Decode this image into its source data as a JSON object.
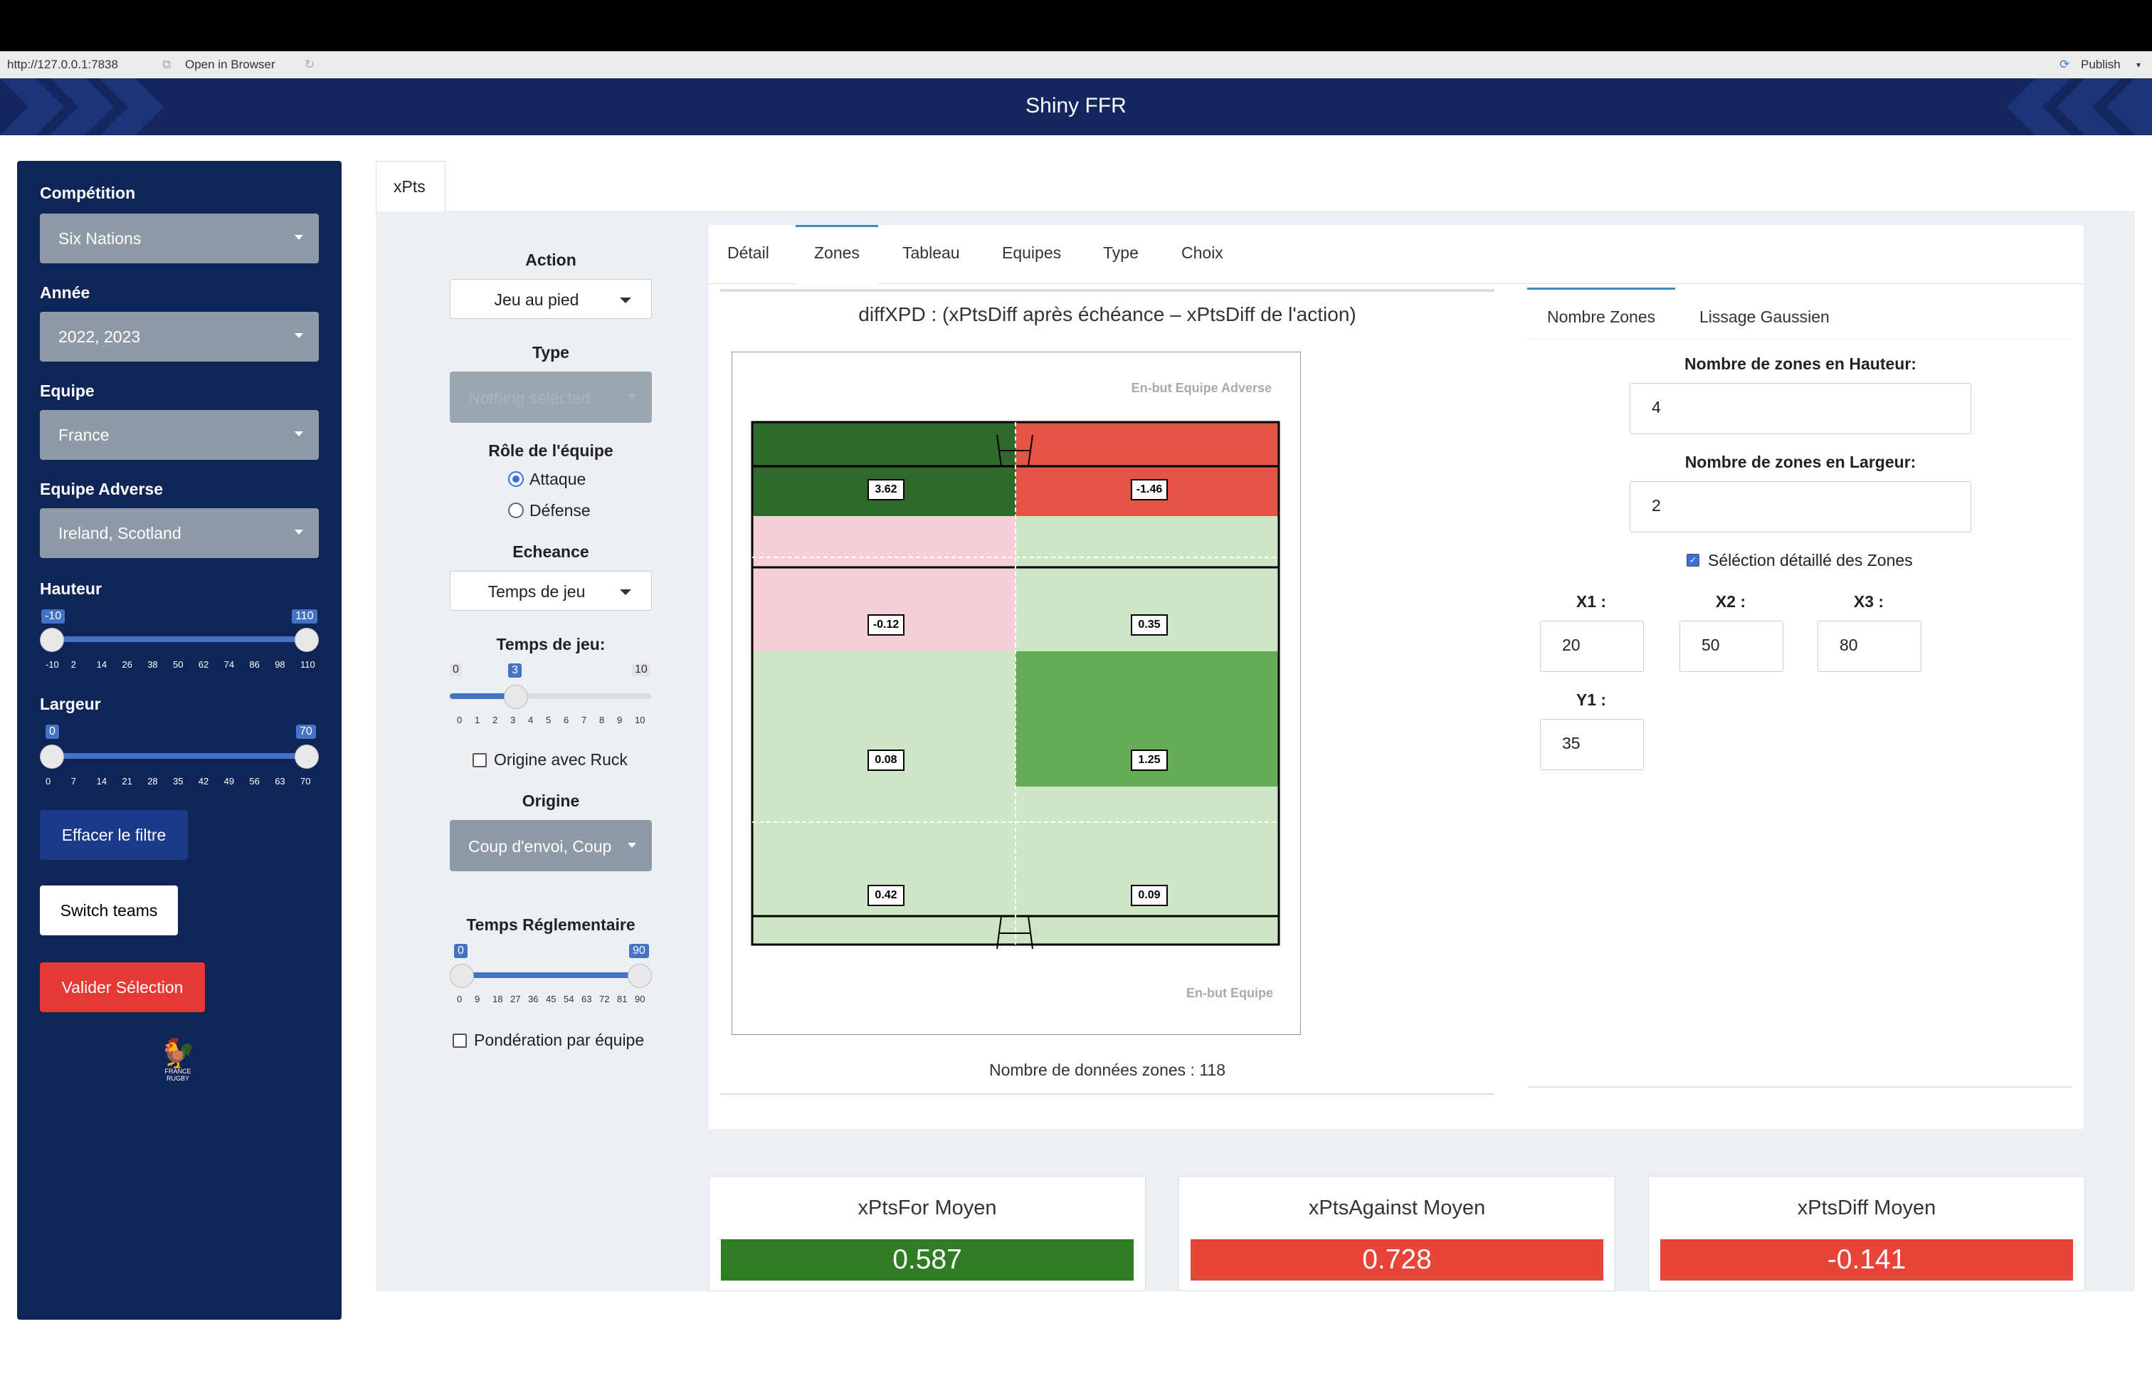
{
  "browser": {
    "url": "http://127.0.0.1:7838",
    "open_in_browser": "Open in Browser",
    "publish": "Publish"
  },
  "app": {
    "title": "Shiny FFR"
  },
  "sidebar": {
    "competition": {
      "label": "Compétition",
      "value": "Six Nations"
    },
    "annee": {
      "label": "Année",
      "value": "2022, 2023"
    },
    "equipe": {
      "label": "Equipe",
      "value": "France"
    },
    "equipe_adverse": {
      "label": "Equipe Adverse",
      "value": "Ireland, Scotland"
    },
    "hauteur": {
      "label": "Hauteur",
      "min_value": "-10",
      "max_value": "110",
      "ticks": [
        "-10",
        "2",
        "14",
        "26",
        "38",
        "50",
        "62",
        "74",
        "86",
        "98",
        "110"
      ]
    },
    "largeur": {
      "label": "Largeur",
      "min_value": "0",
      "max_value": "70",
      "ticks": [
        "0",
        "7",
        "14",
        "21",
        "28",
        "35",
        "42",
        "49",
        "56",
        "63",
        "70"
      ]
    },
    "clear_button": "Effacer le filtre",
    "switch_button": "Switch teams",
    "validate_button": "Valider Sélection",
    "logo_text_1": "FRANCE",
    "logo_text_2": "RUGBY",
    "colors": {
      "bg": "#0f2558",
      "validate": "#e53935",
      "clear": "#1b3a8c"
    }
  },
  "main_tab": "xPts",
  "controls": {
    "action": {
      "label": "Action",
      "value": "Jeu au pied"
    },
    "type": {
      "label": "Type",
      "placeholder": "Nothing selected"
    },
    "role": {
      "label": "Rôle de l'équipe",
      "options": [
        "Attaque",
        "Défense"
      ],
      "selected": "Attaque"
    },
    "echeance": {
      "label": "Echeance",
      "value": "Temps de jeu"
    },
    "temps_jeu": {
      "label": "Temps de jeu:",
      "min": "0",
      "value": "3",
      "max": "10",
      "ticks": [
        "0",
        "1",
        "2",
        "3",
        "4",
        "5",
        "6",
        "7",
        "8",
        "9",
        "10"
      ]
    },
    "origine_ruck": "Origine avec Ruck",
    "origine": {
      "label": "Origine",
      "value": "Coup d'envoi, Coup"
    },
    "temps_reglementaire": {
      "label": "Temps Réglementaire",
      "min_value": "0",
      "max_value": "90",
      "ticks": [
        "0",
        "9",
        "18",
        "27",
        "36",
        "45",
        "54",
        "63",
        "72",
        "81",
        "90"
      ]
    },
    "ponderation": "Pondération par équipe"
  },
  "tabs": [
    "Détail",
    "Zones",
    "Tableau",
    "Equipes",
    "Type",
    "Choix"
  ],
  "active_tab": "Zones",
  "plot": {
    "title": "diffXPD : (xPtsDiff après échéance – xPtsDiff de l'action)",
    "top_label": "En-but Equipe Adverse",
    "bottom_label": "En-but Equipe",
    "zones": [
      {
        "value": "3.62",
        "color": "#2e6b2a"
      },
      {
        "value": "-1.46",
        "color": "#e45444"
      },
      {
        "value": "-0.12",
        "color": "#f5d0d6"
      },
      {
        "value": "0.35",
        "color": "#cde6c6"
      },
      {
        "value": "0.08",
        "color": "#cde6c6"
      },
      {
        "value": "1.25",
        "color": "#65ad55"
      },
      {
        "value": "0.42",
        "color": "#cde6c6"
      },
      {
        "value": "0.09",
        "color": "#cde6c6"
      }
    ],
    "count_text": "Nombre de données zones : 118"
  },
  "right_panel": {
    "tabs": [
      "Nombre Zones",
      "Lissage Gaussien"
    ],
    "active_tab": "Nombre Zones",
    "hauteur_label": "Nombre de zones en Hauteur:",
    "hauteur_value": "4",
    "largeur_label": "Nombre de zones en Largeur:",
    "largeur_value": "2",
    "detail_check": "Séléction détaillé des Zones",
    "x1": {
      "label": "X1 :",
      "value": "20"
    },
    "x2": {
      "label": "X2 :",
      "value": "50"
    },
    "x3": {
      "label": "X3 :",
      "value": "80"
    },
    "y1": {
      "label": "Y1 :",
      "value": "35"
    }
  },
  "value_boxes": [
    {
      "title": "xPtsFor Moyen",
      "value": "0.587",
      "color": "#2e7d23"
    },
    {
      "title": "xPtsAgainst Moyen",
      "value": "0.728",
      "color": "#e8443a"
    },
    {
      "title": "xPtsDiff Moyen",
      "value": "-0.141",
      "color": "#e8443a"
    }
  ]
}
